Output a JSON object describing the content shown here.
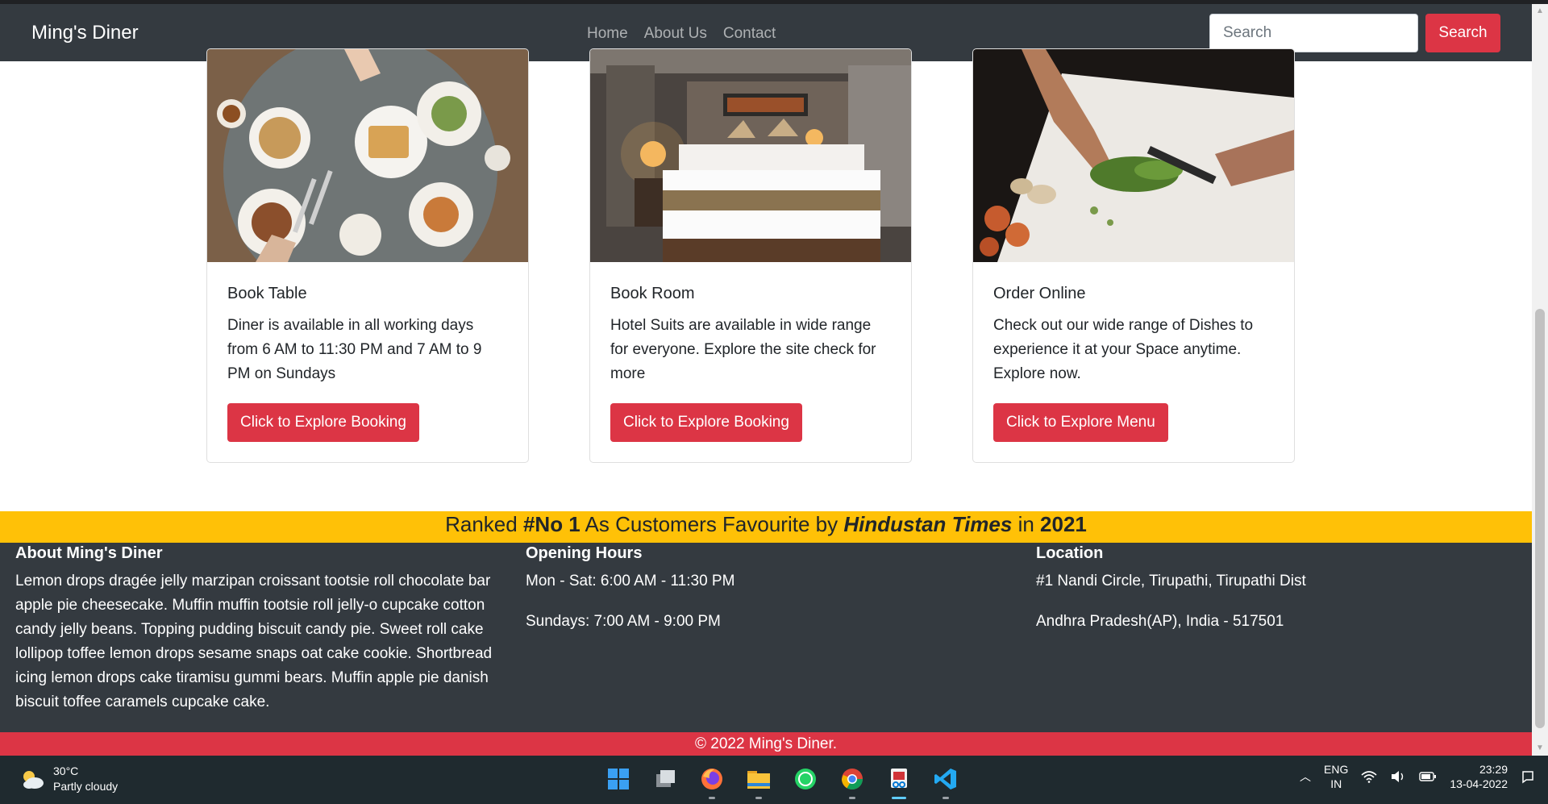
{
  "nav": {
    "brand": "Ming's Diner",
    "links": [
      "Home",
      "About Us",
      "Contact"
    ],
    "search_placeholder": "Search",
    "search_button": "Search"
  },
  "cards": [
    {
      "title": "Book Table",
      "text": "Diner is available in all working days from 6 AM to 11:30 PM and 7 AM to 9 PM on Sundays",
      "button": "Click to Explore Booking",
      "image_icon": "dining-table-photo"
    },
    {
      "title": "Book Room",
      "text": "Hotel Suits are available in wide range for everyone. Explore the site check for more",
      "button": "Click to Explore Booking",
      "image_icon": "hotel-room-photo"
    },
    {
      "title": "Order Online",
      "text": "Check out our wide range of Dishes to experience it at your Space anytime. Explore now.",
      "button": "Click to Explore Menu",
      "image_icon": "chef-chopping-photo"
    }
  ],
  "banner": {
    "part1": "Ranked ",
    "rank": "#No 1",
    "part2": " As Customers Favourite by ",
    "source": "Hindustan Times",
    "part3": " in ",
    "year": "2021"
  },
  "footer": {
    "about_heading": "About Ming's Diner",
    "about_text": "Lemon drops dragée jelly marzipan croissant tootsie roll chocolate bar apple pie cheesecake. Muffin muffin tootsie roll jelly-o cupcake cotton candy jelly beans. Topping pudding biscuit candy pie. Sweet roll cake lollipop toffee lemon drops sesame snaps oat cake cookie. Shortbread icing lemon drops cake tiramisu gummi bears. Muffin apple pie danish biscuit toffee caramels cupcake cake.",
    "hours_heading": "Opening Hours",
    "hours_line1": "Mon - Sat: 6:00 AM - 11:30 PM",
    "hours_line2": "Sundays: 7:00 AM - 9:00 PM",
    "location_heading": "Location",
    "location_line1": "#1 Nandi Circle, Tirupathi, Tirupathi Dist",
    "location_line2": "Andhra Pradesh(AP), India - 517501",
    "copyright": "© 2022 Ming's Diner."
  },
  "taskbar": {
    "temperature": "30°C",
    "weather": "Partly cloudy",
    "apps": [
      "windows-start-icon",
      "task-view-icon",
      "firefox-icon",
      "file-explorer-icon",
      "whatsapp-icon",
      "chrome-icon",
      "snipping-tool-icon",
      "vscode-icon"
    ],
    "lang1": "ENG",
    "lang2": "IN",
    "time": "23:29",
    "date": "13-04-2022"
  },
  "colors": {
    "navbar": "#343a40",
    "accent_red": "#dc3545",
    "banner_yellow": "#ffc107"
  }
}
